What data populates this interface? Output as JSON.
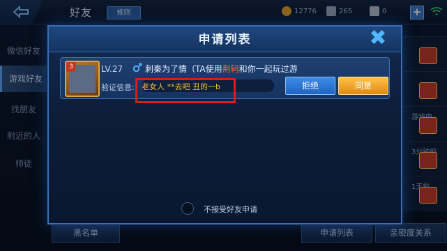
{
  "topbar": {
    "title": "好友",
    "rule_label": "规则",
    "gold": "12776",
    "diamond": "265",
    "voucher": "0",
    "plus_label": "+"
  },
  "leftnav": {
    "items": [
      {
        "label": "微信好友"
      },
      {
        "label": "游戏好友"
      },
      {
        "label": "找朋友"
      },
      {
        "label": "附近的人"
      },
      {
        "label": "师徒"
      }
    ]
  },
  "rightlist": {
    "items": [
      {
        "text": ""
      },
      {
        "text": ""
      },
      {
        "text": "游戏中"
      },
      {
        "text": "3分钟前"
      },
      {
        "text": "1天前"
      }
    ]
  },
  "bottom": {
    "blacklist_label": "黑名单",
    "requests_label": "申请列表",
    "intimacy_label": "亲密度关系"
  },
  "modal": {
    "title": "申请列表",
    "close_symbol": "✖",
    "request": {
      "rank": "3",
      "level": "LV.27",
      "name_prefix": "刺秦为了情（TA使用",
      "hero": "荆轲",
      "name_suffix": "和你一起玩过游",
      "verify_label": "验证信息:",
      "verify_text": "老女人 **去吧 丑的一b",
      "reject_label": "拒绝",
      "accept_label": "同意"
    },
    "toggle_label": "不接受好友申请"
  }
}
